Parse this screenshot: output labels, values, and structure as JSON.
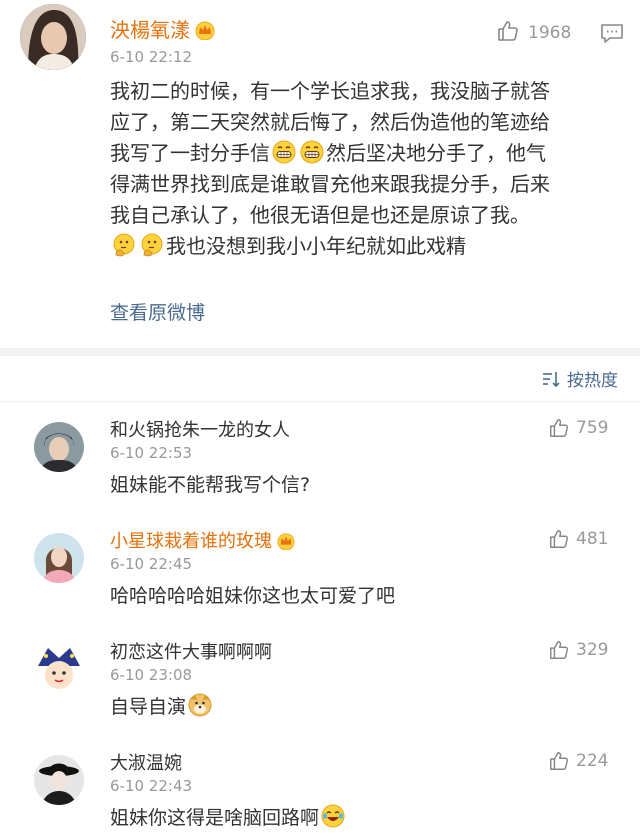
{
  "post": {
    "author": "泱楊氧漾",
    "time": "6-10 22:12",
    "likes": "1968",
    "lines": [
      "我初二的时候，有一个学长追求我，我没脑子就答",
      "应了，第二天突然就后悔了，然后伪造他的笔迹给",
      [
        "我写了一封分手信",
        "然后坚决地分手了，他气"
      ],
      "得满世界找到底是谁敢冒充他来跟我提分手，后来",
      "我自己承认了，他很无语但是也还是原谅了我。",
      "我也没想到我小小年纪就如此戏精"
    ],
    "view_original": "查看原微博"
  },
  "sort": {
    "label": "按热度"
  },
  "comments": [
    {
      "name": "和火锅抢朱一龙的女人",
      "time": "6-10 22:53",
      "text": "姐妹能不能帮我写个信?",
      "likes": "759"
    },
    {
      "name": "小星球栽着谁的玫瑰",
      "time": "6-10 22:45",
      "text": "哈哈哈哈哈姐妹你这也太可爱了吧",
      "likes": "481"
    },
    {
      "name": "初恋这件大事啊啊啊",
      "time": "6-10 23:08",
      "text": "自导自演",
      "likes": "329"
    },
    {
      "name": "大淑温婉",
      "time": "6-10 22:43",
      "text": "姐妹你这得是啥脑回路啊",
      "likes": "224"
    }
  ],
  "colors": {
    "accent_orange": "#e8720c",
    "link_blue": "#4a6b91",
    "meta_gray": "#999999",
    "text_dark": "#333333",
    "separator": "#f2f2f2"
  },
  "icons": {
    "vip": "crown-badge-icon",
    "like": "thumbs-up-icon",
    "comment": "comment-bubble-icon",
    "sort": "sort-icon",
    "emoji_grin": "grin-emoji-icon",
    "emoji_think": "thinking-emoji-icon",
    "emoji_doge": "doge-emoji-icon",
    "emoji_laugh": "laugh-tears-emoji-icon"
  }
}
